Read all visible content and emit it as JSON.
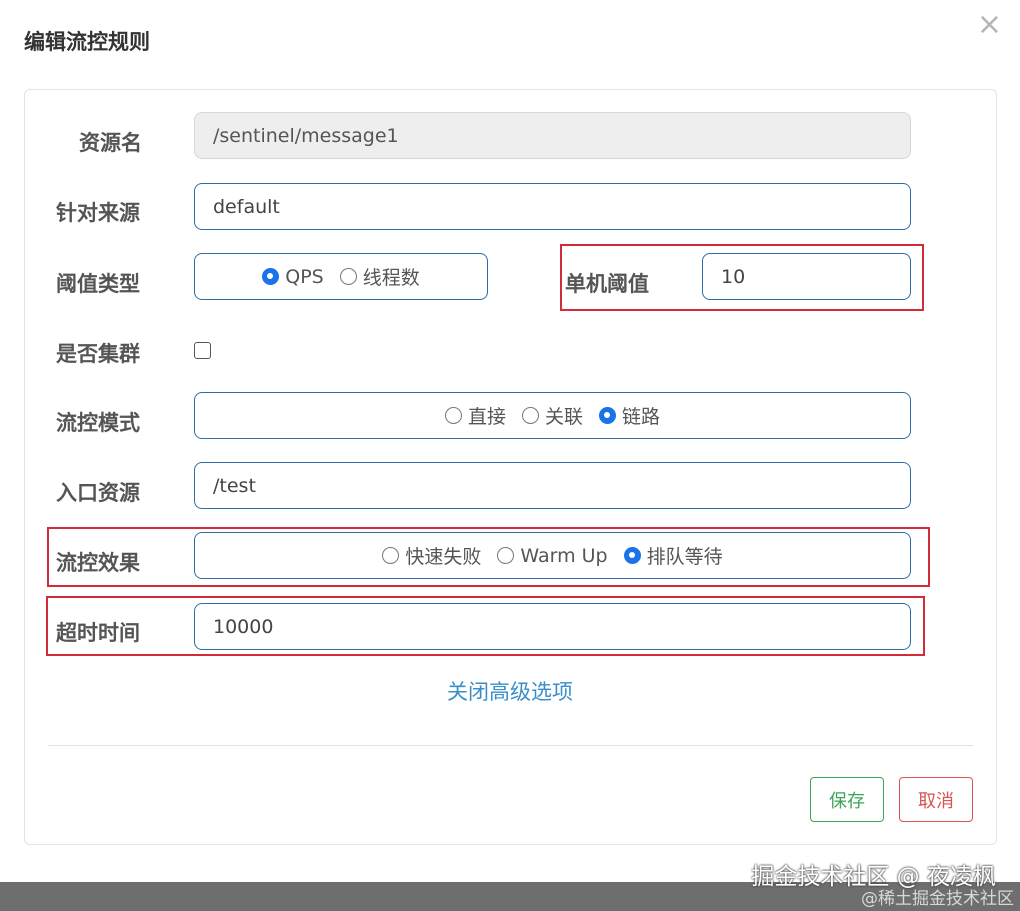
{
  "dialog": {
    "title": "编辑流控规则",
    "close_glyph": "×"
  },
  "form": {
    "resource_name": {
      "label": "资源名",
      "value": "/sentinel/message1"
    },
    "limit_app": {
      "label": "针对来源",
      "value": "default"
    },
    "threshold_type": {
      "label": "阈值类型",
      "options": [
        "QPS",
        "线程数"
      ],
      "selected": "QPS"
    },
    "single_threshold": {
      "label": "单机阈值",
      "value": "10"
    },
    "cluster_mode": {
      "label": "是否集群",
      "checked": false
    },
    "flow_mode": {
      "label": "流控模式",
      "options": [
        "直接",
        "关联",
        "链路"
      ],
      "selected": "链路"
    },
    "entry_resource": {
      "label": "入口资源",
      "value": "/test"
    },
    "control_behavior": {
      "label": "流控效果",
      "options": [
        "快速失败",
        "Warm Up",
        "排队等待"
      ],
      "selected": "排队等待"
    },
    "timeout": {
      "label": "超时时间",
      "value": "10000"
    },
    "advanced_toggle": "关闭高级选项"
  },
  "footer": {
    "save_label": "保存",
    "cancel_label": "取消"
  },
  "watermark": {
    "line1": "掘金技术社区 @ 夜凌枫",
    "line2": "@稀土掘金技术社区"
  },
  "colors": {
    "input_border": "#2d6da3",
    "highlight_box": "#d22c3c",
    "link": "#3a8fc9",
    "save": "#3aa657",
    "cancel": "#d9534f",
    "radio_checked": "#1a73e8"
  }
}
